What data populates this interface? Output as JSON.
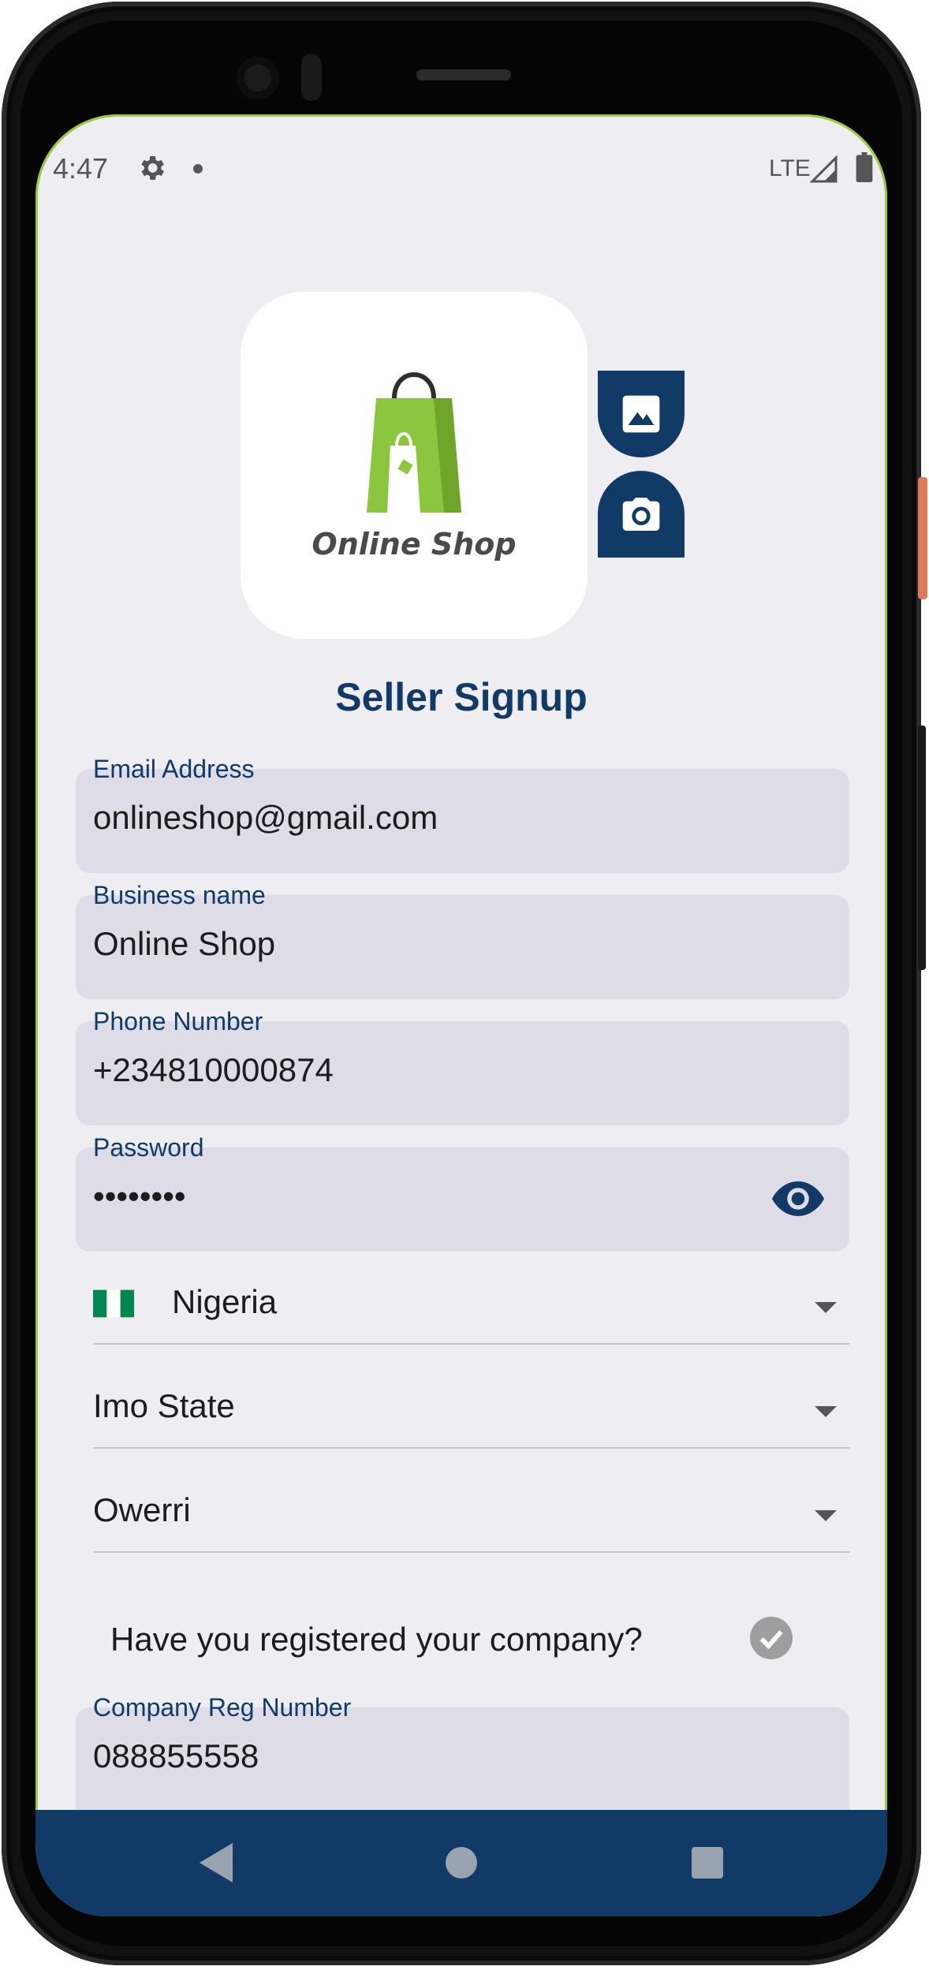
{
  "status_bar": {
    "time": "4:47",
    "network": "LTE",
    "icons": [
      "gear-icon",
      "notification-dot-icon",
      "signal-icon",
      "battery-icon"
    ]
  },
  "logo": {
    "text": "Online Shop",
    "icon": "shopping-bag-icon",
    "colors": {
      "bag": "#8cc63f",
      "text": "#4a4a4a"
    }
  },
  "image_actions": {
    "gallery_icon": "image-icon",
    "camera_icon": "camera-icon"
  },
  "form": {
    "title": "Seller Signup",
    "fields": {
      "email": {
        "label": "Email Address",
        "value": "onlineshop@gmail.com"
      },
      "business": {
        "label": "Business name",
        "value": "Online Shop"
      },
      "phone": {
        "label": "Phone Number",
        "value": "+234810000874"
      },
      "password": {
        "label": "Password",
        "value": "••••••••",
        "toggle_icon": "eye-icon"
      },
      "company_reg": {
        "label": "Company Reg Number",
        "value": "088855558"
      }
    },
    "country": {
      "value": "Nigeria",
      "flag": "nigeria-flag-icon"
    },
    "state": {
      "value": "Imo State"
    },
    "city": {
      "value": "Owerri"
    },
    "registered_question": "Have you registered your company?",
    "registered_checked": true
  },
  "nav_bar": {
    "icons": [
      "back-icon",
      "home-icon",
      "recents-icon"
    ]
  },
  "colors": {
    "primary": "#113a66",
    "field_bg": "#dedce6",
    "screen_bg": "#eeedf2",
    "accent_border": "#9acd3a"
  }
}
